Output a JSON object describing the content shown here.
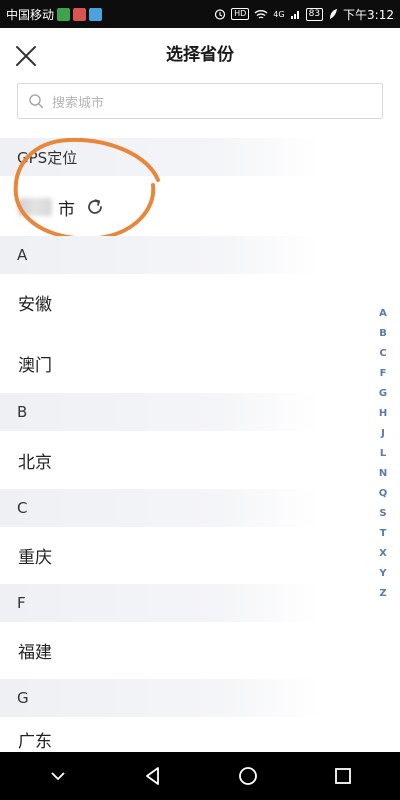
{
  "status_bar": {
    "carrier": "中国移动",
    "hd": "HD",
    "network": "4G",
    "battery": "83",
    "time": "下午3:12"
  },
  "header": {
    "title": "选择省份",
    "close_icon": "close-icon"
  },
  "search": {
    "placeholder": "搜索城市"
  },
  "gps": {
    "section_label": "GPS定位",
    "city_suffix": "市"
  },
  "sections": [
    {
      "letter": "A",
      "items": [
        "安徽",
        "澳门"
      ]
    },
    {
      "letter": "B",
      "items": [
        "北京"
      ]
    },
    {
      "letter": "C",
      "items": [
        "重庆"
      ]
    },
    {
      "letter": "F",
      "items": [
        "福建"
      ]
    },
    {
      "letter": "G",
      "items": [
        "广东"
      ]
    }
  ],
  "alpha_index": [
    "A",
    "B",
    "C",
    "F",
    "G",
    "H",
    "J",
    "L",
    "N",
    "Q",
    "S",
    "T",
    "X",
    "Y",
    "Z"
  ],
  "colors": {
    "annotation": "#e8873a",
    "index_letter": "#5b7ab0"
  }
}
